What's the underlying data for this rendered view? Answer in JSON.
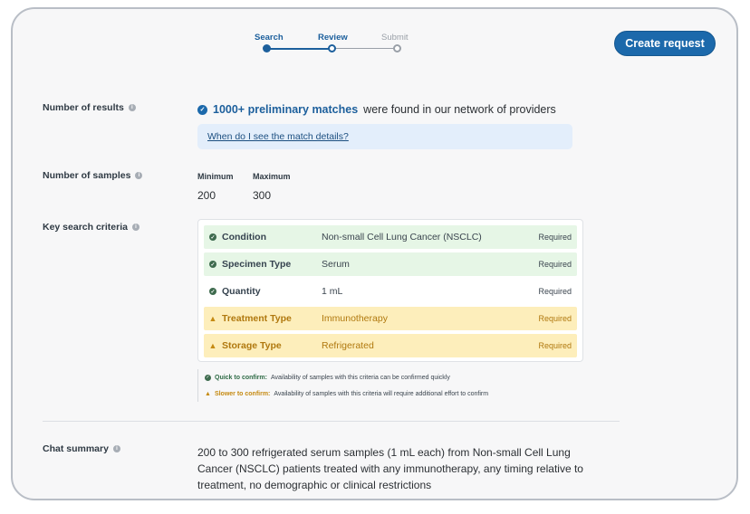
{
  "stepper": {
    "steps": [
      {
        "label": "Search",
        "state": "done"
      },
      {
        "label": "Review",
        "state": "current"
      },
      {
        "label": "Submit",
        "state": "future"
      }
    ]
  },
  "header": {
    "create_label": "Create request"
  },
  "results": {
    "label": "Number of results",
    "matches_strong": "1000+ preliminary matches",
    "matches_rest": "were found in our network of providers",
    "details_link": "When do I see the match details?"
  },
  "samples": {
    "label": "Number of samples",
    "min_label": "Minimum",
    "min_value": "200",
    "max_label": "Maximum",
    "max_value": "300"
  },
  "criteria": {
    "label": "Key search criteria",
    "rows": [
      {
        "name": "Condition",
        "value": "Non-small Cell Lung Cancer (NSCLC)",
        "req": "Required",
        "status": "quick"
      },
      {
        "name": "Specimen Type",
        "value": "Serum",
        "req": "Required",
        "status": "quick"
      },
      {
        "name": "Quantity",
        "value": "1 mL",
        "req": "Required",
        "status": "quick"
      },
      {
        "name": "Treatment Type",
        "value": "Immunotherapy",
        "req": "Required",
        "status": "slow"
      },
      {
        "name": "Storage Type",
        "value": "Refrigerated",
        "req": "Required",
        "status": "slow"
      }
    ],
    "legend_quick_key": "Quick to confirm:",
    "legend_quick_text": "Availability of samples with this criteria can be confirmed quickly",
    "legend_slow_key": "Slower to confirm:",
    "legend_slow_text": "Availability of samples with this criteria will require additional effort to confirm"
  },
  "chat": {
    "label": "Chat summary",
    "text": "200 to 300 refrigerated serum samples (1 mL each) from Non-small Cell Lung Cancer (NSCLC) patients treated with any immunotherapy, any timing relative to treatment, no demographic or clinical restrictions"
  },
  "colors": {
    "accent": "#1c69ab",
    "quick_bg": "#e6f6e6",
    "slow_bg": "#fdeebb",
    "slow_text": "#b0780e"
  }
}
